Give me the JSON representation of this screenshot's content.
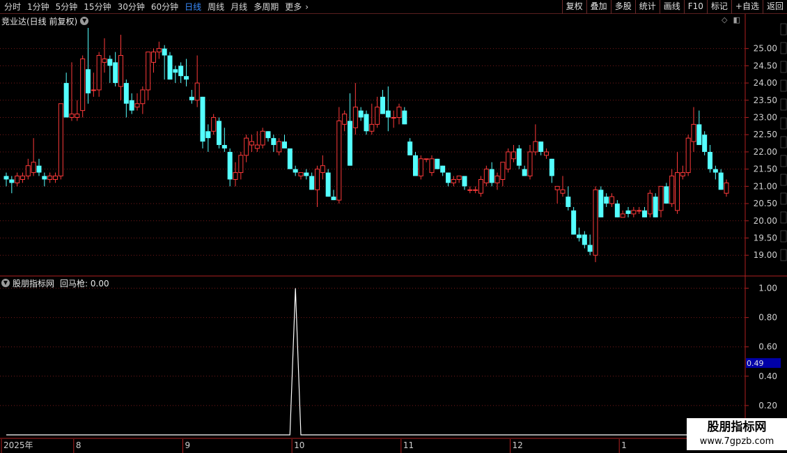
{
  "toolbar": {
    "periods": [
      "分时",
      "1分钟",
      "5分钟",
      "15分钟",
      "30分钟",
      "60分钟",
      "日线",
      "周线",
      "月线",
      "多周期",
      "更多"
    ],
    "more_arrow": "›",
    "active": "日线",
    "buttons": [
      "复权",
      "叠加",
      "多股",
      "统计",
      "画线",
      "F10",
      "标记",
      "+自选",
      "返回"
    ]
  },
  "main_chart": {
    "title": "竞业达(日线 前复权)",
    "icon": "chevron-down-icon",
    "y_ticks": [
      "25.00",
      "24.50",
      "24.00",
      "23.50",
      "23.00",
      "22.50",
      "22.00",
      "21.50",
      "21.00",
      "20.50",
      "20.00",
      "19.50",
      "19.00"
    ]
  },
  "indicator": {
    "name": "股朋指标网",
    "label": "回马枪: 0.00",
    "y_ticks": [
      "1.00",
      "0.80",
      "0.60",
      "0.40",
      "0.20"
    ],
    "current_value": "0.49"
  },
  "date_axis": {
    "labels": [
      "2025年",
      "8",
      "9",
      "10",
      "11",
      "12",
      "1"
    ]
  },
  "watermark": {
    "line1": "股朋指标网",
    "line2": "www.7gpzb.com"
  },
  "colors": {
    "up": "#ff3a3a",
    "down": "#54ffff",
    "grid": "#7a1a1a",
    "border": "#b02020",
    "axis_text": "#d0d0d0",
    "highlight": "#0000a8"
  },
  "chart_data": {
    "type": "candlestick",
    "y_range": [
      18.6,
      25.6
    ],
    "indicator_range": [
      0,
      1.05
    ],
    "candles": [
      [
        21.3,
        21.4,
        21.0,
        21.2
      ],
      [
        21.2,
        21.3,
        20.8,
        21.1
      ],
      [
        21.1,
        21.4,
        21.0,
        21.3
      ],
      [
        21.2,
        21.4,
        21.1,
        21.3
      ],
      [
        21.3,
        21.8,
        21.2,
        21.6
      ],
      [
        21.4,
        22.4,
        21.3,
        21.7
      ],
      [
        21.6,
        21.8,
        21.3,
        21.4
      ],
      [
        21.3,
        21.4,
        21.0,
        21.2
      ],
      [
        21.2,
        21.4,
        21.1,
        21.3
      ],
      [
        21.2,
        21.4,
        21.1,
        21.3
      ],
      [
        21.3,
        23.4,
        21.2,
        23.4
      ],
      [
        24.0,
        24.3,
        23.0,
        23.0
      ],
      [
        23.0,
        24.6,
        22.9,
        23.1
      ],
      [
        23.0,
        23.5,
        22.9,
        23.1
      ],
      [
        23.2,
        24.8,
        23.0,
        24.7
      ],
      [
        24.4,
        25.6,
        23.4,
        23.7
      ],
      [
        23.8,
        24.3,
        23.6,
        23.8
      ],
      [
        23.8,
        24.9,
        23.6,
        24.8
      ],
      [
        24.6,
        25.3,
        24.3,
        24.7
      ],
      [
        24.7,
        24.8,
        24.0,
        24.5
      ],
      [
        24.6,
        24.9,
        23.9,
        24.0
      ],
      [
        23.9,
        25.4,
        23.5,
        24.8
      ],
      [
        24.0,
        24.1,
        23.0,
        23.4
      ],
      [
        23.5,
        23.7,
        23.1,
        23.2
      ],
      [
        23.3,
        23.7,
        23.2,
        23.4
      ],
      [
        23.4,
        23.9,
        23.1,
        23.8
      ],
      [
        23.8,
        24.9,
        23.5,
        24.9
      ],
      [
        24.6,
        25.0,
        24.3,
        24.9
      ],
      [
        24.9,
        25.2,
        24.7,
        25.0
      ],
      [
        25.0,
        25.1,
        24.1,
        24.8
      ],
      [
        24.8,
        24.9,
        24.1,
        24.1
      ],
      [
        24.4,
        24.5,
        24.0,
        24.3
      ],
      [
        24.5,
        24.6,
        24.0,
        24.2
      ],
      [
        24.2,
        24.7,
        23.9,
        24.1
      ],
      [
        23.6,
        23.8,
        23.4,
        23.5
      ],
      [
        23.5,
        24.8,
        23.3,
        24.0
      ],
      [
        23.6,
        23.6,
        22.1,
        22.3
      ],
      [
        22.6,
        22.8,
        22.0,
        22.4
      ],
      [
        22.6,
        23.1,
        22.5,
        23.0
      ],
      [
        22.9,
        23.0,
        22.1,
        22.2
      ],
      [
        22.2,
        22.7,
        22.0,
        22.1
      ],
      [
        22.0,
        22.1,
        21.0,
        21.2
      ],
      [
        21.2,
        21.7,
        21.0,
        21.4
      ],
      [
        21.4,
        22.0,
        21.2,
        21.9
      ],
      [
        21.9,
        22.5,
        21.7,
        22.4
      ],
      [
        22.2,
        22.5,
        22.0,
        22.3
      ],
      [
        22.1,
        22.6,
        22.0,
        22.2
      ],
      [
        22.2,
        22.7,
        22.1,
        22.6
      ],
      [
        22.6,
        22.6,
        22.3,
        22.4
      ],
      [
        22.4,
        22.5,
        22.0,
        22.2
      ],
      [
        22.0,
        22.4,
        21.9,
        22.3
      ],
      [
        22.3,
        22.5,
        22.1,
        22.1
      ],
      [
        22.1,
        22.1,
        21.5,
        21.5
      ],
      [
        21.5,
        21.6,
        21.3,
        21.4
      ],
      [
        21.3,
        21.4,
        21.2,
        21.4
      ],
      [
        21.4,
        21.5,
        21.2,
        21.3
      ],
      [
        21.3,
        21.4,
        20.9,
        20.9
      ],
      [
        20.9,
        21.6,
        20.4,
        21.5
      ],
      [
        21.4,
        21.9,
        21.2,
        21.6
      ],
      [
        21.4,
        21.5,
        20.7,
        20.7
      ],
      [
        20.7,
        20.9,
        20.6,
        20.6
      ],
      [
        20.6,
        23.3,
        20.5,
        22.9
      ],
      [
        22.8,
        23.2,
        22.6,
        23.1
      ],
      [
        22.9,
        23.7,
        21.6,
        21.6
      ],
      [
        22.7,
        24.0,
        22.5,
        23.3
      ],
      [
        23.2,
        23.3,
        22.9,
        23.0
      ],
      [
        23.1,
        23.2,
        22.5,
        22.6
      ],
      [
        22.6,
        23.4,
        22.5,
        22.8
      ],
      [
        22.8,
        23.6,
        22.7,
        23.3
      ],
      [
        23.6,
        23.8,
        23.1,
        23.1
      ],
      [
        23.2,
        23.9,
        22.6,
        23.0
      ],
      [
        23.0,
        23.2,
        22.7,
        23.0
      ],
      [
        23.0,
        23.4,
        22.8,
        23.3
      ],
      [
        23.2,
        23.3,
        22.8,
        22.8
      ],
      [
        22.3,
        22.4,
        21.9,
        21.9
      ],
      [
        21.9,
        22.0,
        21.3,
        21.3
      ],
      [
        21.3,
        21.9,
        21.2,
        21.8
      ],
      [
        21.8,
        21.8,
        21.7,
        21.8
      ],
      [
        21.4,
        21.9,
        21.3,
        21.8
      ],
      [
        21.8,
        21.8,
        21.5,
        21.5
      ],
      [
        21.6,
        21.6,
        21.3,
        21.4
      ],
      [
        21.4,
        21.4,
        21.0,
        21.1
      ],
      [
        21.1,
        21.3,
        21.0,
        21.2
      ],
      [
        21.2,
        21.3,
        21.1,
        21.3
      ],
      [
        21.3,
        21.3,
        20.9,
        21.0
      ],
      [
        20.9,
        21.0,
        20.8,
        20.9
      ],
      [
        20.9,
        21.0,
        20.8,
        20.9
      ],
      [
        20.8,
        21.3,
        20.7,
        21.2
      ],
      [
        21.1,
        21.6,
        21.0,
        21.5
      ],
      [
        21.5,
        21.7,
        21.0,
        21.1
      ],
      [
        21.1,
        21.4,
        20.9,
        21.3
      ],
      [
        21.2,
        21.7,
        21.0,
        21.7
      ],
      [
        21.5,
        22.1,
        21.4,
        22.0
      ],
      [
        21.8,
        22.2,
        21.7,
        22.0
      ],
      [
        22.1,
        22.2,
        21.5,
        21.6
      ],
      [
        21.5,
        21.6,
        21.3,
        21.3
      ],
      [
        21.3,
        22.2,
        21.2,
        22.0
      ],
      [
        22.0,
        22.8,
        21.9,
        22.3
      ],
      [
        22.3,
        22.3,
        21.9,
        22.0
      ],
      [
        21.9,
        22.1,
        21.8,
        22.0
      ],
      [
        21.8,
        21.8,
        21.1,
        21.3
      ],
      [
        20.9,
        21.0,
        20.5,
        21.0
      ],
      [
        20.8,
        21.3,
        20.7,
        20.9
      ],
      [
        20.7,
        21.0,
        20.3,
        20.4
      ],
      [
        20.3,
        20.4,
        19.6,
        19.6
      ],
      [
        19.6,
        19.8,
        19.4,
        19.5
      ],
      [
        19.6,
        19.7,
        19.2,
        19.3
      ],
      [
        19.3,
        19.6,
        19.0,
        19.1
      ],
      [
        19.0,
        21.0,
        18.8,
        20.9
      ],
      [
        20.9,
        21.0,
        20.1,
        20.1
      ],
      [
        20.7,
        20.8,
        20.4,
        20.5
      ],
      [
        20.5,
        20.8,
        20.4,
        20.7
      ],
      [
        20.5,
        20.6,
        20.1,
        20.1
      ],
      [
        20.1,
        20.3,
        20.1,
        20.2
      ],
      [
        20.3,
        20.4,
        20.1,
        20.2
      ],
      [
        20.2,
        20.4,
        20.1,
        20.3
      ],
      [
        20.3,
        20.4,
        20.2,
        20.3
      ],
      [
        20.3,
        20.4,
        20.1,
        20.1
      ],
      [
        20.2,
        20.9,
        20.1,
        20.8
      ],
      [
        20.7,
        20.8,
        20.1,
        20.1
      ],
      [
        20.3,
        21.0,
        20.1,
        21.0
      ],
      [
        21.0,
        21.1,
        20.5,
        20.5
      ],
      [
        20.5,
        21.5,
        20.4,
        21.3
      ],
      [
        20.3,
        22.0,
        20.2,
        21.4
      ],
      [
        21.3,
        21.6,
        21.2,
        21.4
      ],
      [
        21.4,
        22.5,
        21.3,
        22.4
      ],
      [
        22.3,
        23.3,
        22.0,
        22.8
      ],
      [
        22.8,
        23.2,
        22.2,
        22.2
      ],
      [
        22.5,
        22.6,
        21.9,
        22.0
      ],
      [
        22.0,
        22.2,
        21.4,
        21.5
      ],
      [
        21.5,
        21.6,
        21.2,
        21.4
      ],
      [
        21.4,
        21.5,
        20.9,
        20.9
      ],
      [
        20.8,
        21.2,
        20.7,
        21.1
      ]
    ],
    "indicator_values": [
      0,
      0,
      0,
      0,
      0,
      0,
      0,
      0,
      0,
      0,
      0,
      0,
      0,
      0,
      0,
      0,
      0,
      0,
      0,
      0,
      0,
      0,
      0,
      0,
      0,
      0,
      0,
      0,
      0,
      0,
      0,
      0,
      0,
      0,
      0,
      0,
      0,
      0,
      0,
      0,
      0,
      0,
      0,
      0,
      0,
      0,
      0,
      0,
      0,
      0,
      0,
      0,
      0,
      1,
      0,
      0,
      0,
      0,
      0,
      0,
      0,
      0,
      0,
      0,
      0,
      0,
      0,
      0,
      0,
      0,
      0,
      0,
      0,
      0,
      0,
      0,
      0,
      0,
      0,
      0,
      0,
      0,
      0,
      0,
      0,
      0,
      0,
      0,
      0,
      0,
      0,
      0,
      0,
      0,
      0,
      0,
      0,
      0,
      0,
      0,
      0,
      0,
      0,
      0,
      0,
      0,
      0,
      0,
      0,
      0,
      0,
      0,
      0,
      0,
      0,
      0,
      0,
      0,
      0,
      0,
      0,
      0,
      0,
      0,
      0,
      0,
      0,
      0,
      0,
      0,
      0,
      0,
      0,
      0,
      0,
      0,
      0
    ]
  }
}
